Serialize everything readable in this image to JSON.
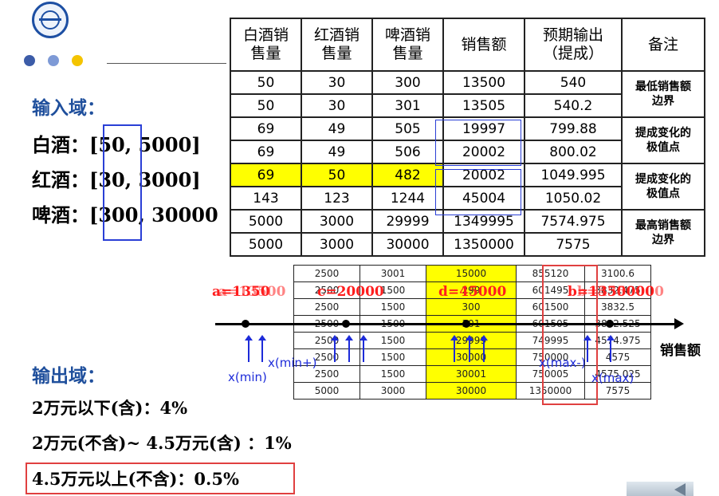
{
  "input_domain": {
    "heading": "输入域：",
    "rows": [
      {
        "label": "白酒：",
        "range": "[50, 5000]"
      },
      {
        "label": "红酒：",
        "range": "[30, 3000]"
      },
      {
        "label": "啤酒：",
        "range": "[300, 30000"
      }
    ]
  },
  "output_domain": {
    "heading": "输出域：",
    "rows": [
      "2万元以下(含)：4%",
      "2万元(不含)~ 4.5万元(含) ：1%",
      "4.5万元以上(不含)：0.5%"
    ]
  },
  "main_table": {
    "headers": [
      "白酒销\n售量",
      "红酒销\n售量",
      "啤酒销\n售量",
      "销售额",
      "预期输出\n（提成）",
      "备注"
    ],
    "rows": [
      [
        "50",
        "30",
        "300",
        "13500",
        "540"
      ],
      [
        "50",
        "30",
        "301",
        "13505",
        "540.2"
      ],
      [
        "69",
        "49",
        "505",
        "19997",
        "799.88"
      ],
      [
        "69",
        "49",
        "506",
        "20002",
        "800.02"
      ],
      [
        "69",
        "50",
        "482",
        "20002",
        "1049.995"
      ],
      [
        "143",
        "123",
        "1244",
        "45004",
        "1050.02"
      ],
      [
        "5000",
        "3000",
        "29999",
        "1349995",
        "7574.975"
      ],
      [
        "5000",
        "3000",
        "30000",
        "1350000",
        "7575"
      ]
    ],
    "notes": [
      "最低销售额\n边界",
      "提成变化的\n极值点",
      "提成变化的\n极值点",
      "最高销售额\n边界"
    ]
  },
  "back_table": {
    "rows": [
      [
        "2500",
        "3001",
        "15000",
        "855120",
        "3100.6"
      ],
      [
        "2500",
        "1500",
        "299",
        "601495",
        "3832.475"
      ],
      [
        "2500",
        "1500",
        "300",
        "601500",
        "3832.5"
      ],
      [
        "2500",
        "1500",
        "301",
        "601505",
        "3832.525"
      ],
      [
        "2500",
        "1500",
        "29999",
        "749995",
        "4574.975"
      ],
      [
        "2500",
        "1500",
        "30000",
        "750000",
        "4575"
      ],
      [
        "2500",
        "1500",
        "30001",
        "750005",
        "4575.025"
      ],
      [
        "5000",
        "3000",
        "30000",
        "1350000",
        "7575"
      ]
    ]
  },
  "axis": {
    "points": {
      "a": "a=1350",
      "a_over": "a=13500",
      "c": "c=20000",
      "d": "d=45000",
      "b": "b=1350000",
      "b_over": "b=4350000"
    },
    "xmin": "x(min)",
    "xmin_plus": "x(min+)",
    "xmax_minus": "x(max-)",
    "xmax": "x(max)",
    "label": "销售额"
  },
  "colors": {
    "highlight": "#ffff00",
    "heading": "#1f4f9c",
    "boundary": "#ff1e1e",
    "marker": "#1d2bd9"
  }
}
